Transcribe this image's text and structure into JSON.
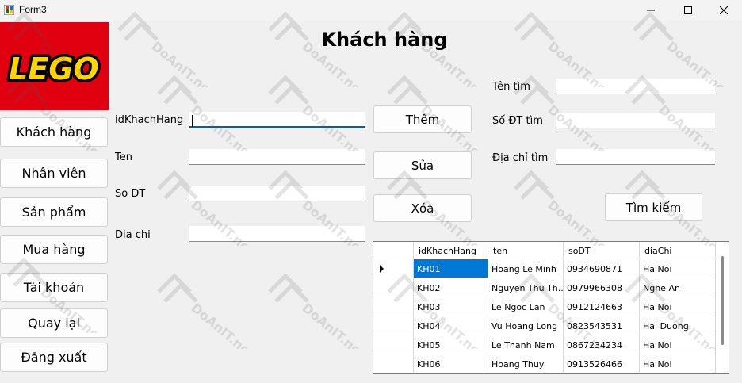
{
  "window": {
    "title": "Form3"
  },
  "logo": {
    "text": "LEGO"
  },
  "nav": {
    "items": [
      "Khách hàng",
      "Nhân viên",
      "Sản phẩm",
      "Mua hàng",
      "Tài khoản",
      "Quay lại",
      "Đăng xuất"
    ]
  },
  "page": {
    "title": "Khách hàng"
  },
  "form": {
    "id_label": "idKhachHang",
    "name_label": "Ten",
    "phone_label": "So DT",
    "address_label": "Dia chi"
  },
  "actions": {
    "add": "Thêm",
    "edit": "Sửa",
    "delete": "Xóa"
  },
  "search": {
    "name_label": "Tên tìm",
    "phone_label": "Số ĐT tìm",
    "address_label": "Địa chỉ tìm",
    "button": "Tìm kiếm"
  },
  "table": {
    "columns": [
      "idKhachHang",
      "ten",
      "soDT",
      "diaChi"
    ],
    "rows": [
      [
        "KH01",
        "Hoang Le Minh",
        "0934690871",
        "Ha Noi"
      ],
      [
        "KH02",
        "Nguyen Thu Th...",
        "0979966308",
        "Nghe An"
      ],
      [
        "KH03",
        "Le Ngoc Lan",
        "0912124663",
        "Ha Noi"
      ],
      [
        "KH04",
        "Vu Hoang Long",
        "0823543531",
        "Hai Duong"
      ],
      [
        "KH05",
        "Le Thanh Nam",
        "0867234234",
        "Ha Noi"
      ],
      [
        "KH06",
        "Hoang Thuy",
        "0913526466",
        "Ha Noi"
      ]
    ],
    "selected_row": 0
  },
  "watermark": "DoAnIT.net",
  "colors": {
    "accent": "#0078d7",
    "logo_red": "#e1000f",
    "logo_yellow": "#ffd500"
  }
}
